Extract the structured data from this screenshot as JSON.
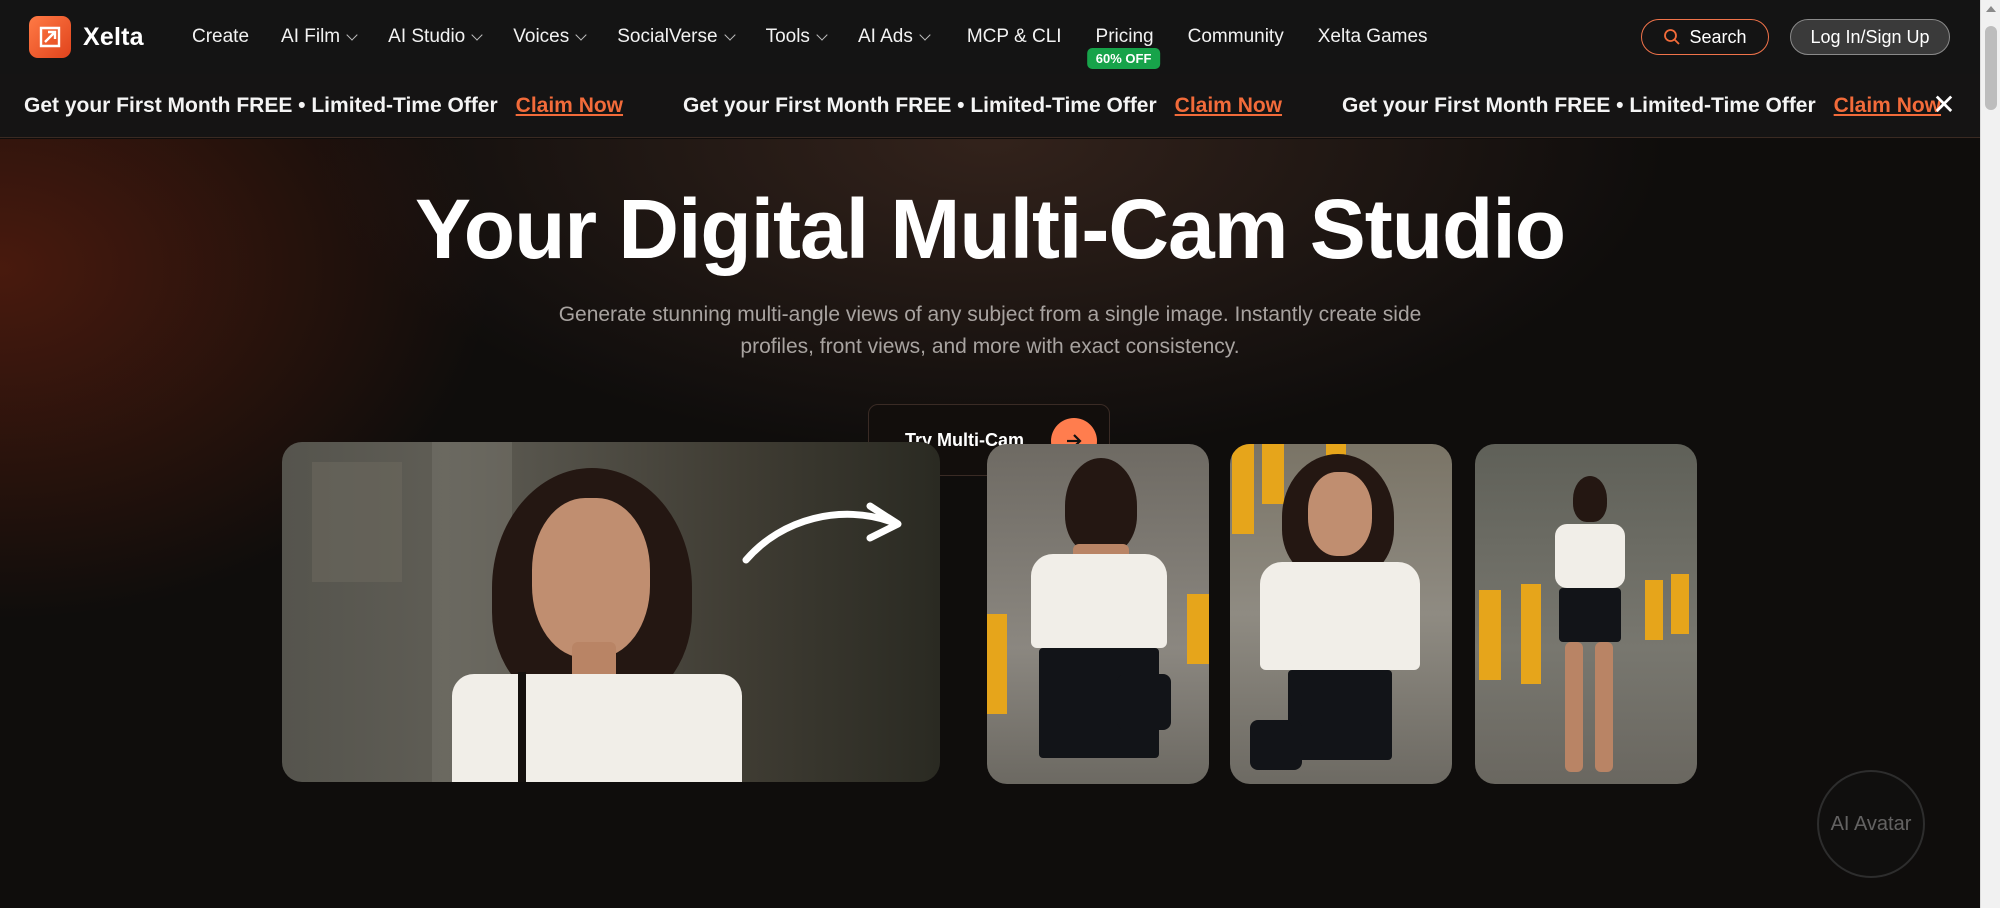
{
  "brand": {
    "name": "Xelta",
    "accent": "#f26b3a"
  },
  "nav": {
    "items": [
      {
        "label": "Create",
        "dropdown": false
      },
      {
        "label": "AI Film",
        "dropdown": true
      },
      {
        "label": "AI Studio",
        "dropdown": true
      },
      {
        "label": "Voices",
        "dropdown": true
      },
      {
        "label": "SocialVerse",
        "dropdown": true
      },
      {
        "label": "Tools",
        "dropdown": true
      },
      {
        "label": "AI Ads",
        "dropdown": true
      },
      {
        "label": "MCP & CLI",
        "dropdown": false
      },
      {
        "label": "Pricing",
        "dropdown": false,
        "badge": "60% OFF"
      },
      {
        "label": "Community",
        "dropdown": false
      },
      {
        "label": "Xelta Games",
        "dropdown": false
      }
    ],
    "search_label": "Search",
    "login_label": "Log In/Sign Up"
  },
  "promo": {
    "text": "Get your First Month FREE • Limited-Time Offer",
    "link": "Claim Now",
    "close_icon": "close-icon"
  },
  "hero": {
    "title": "Your Digital Multi-Cam Studio",
    "subtitle": "Generate stunning multi-angle views of any subject from a single image. Instantly create side profiles, front views, and more with exact consistency.",
    "cta_label": "Try Multi-Cam"
  },
  "floating": {
    "label": "AI Avatar"
  }
}
